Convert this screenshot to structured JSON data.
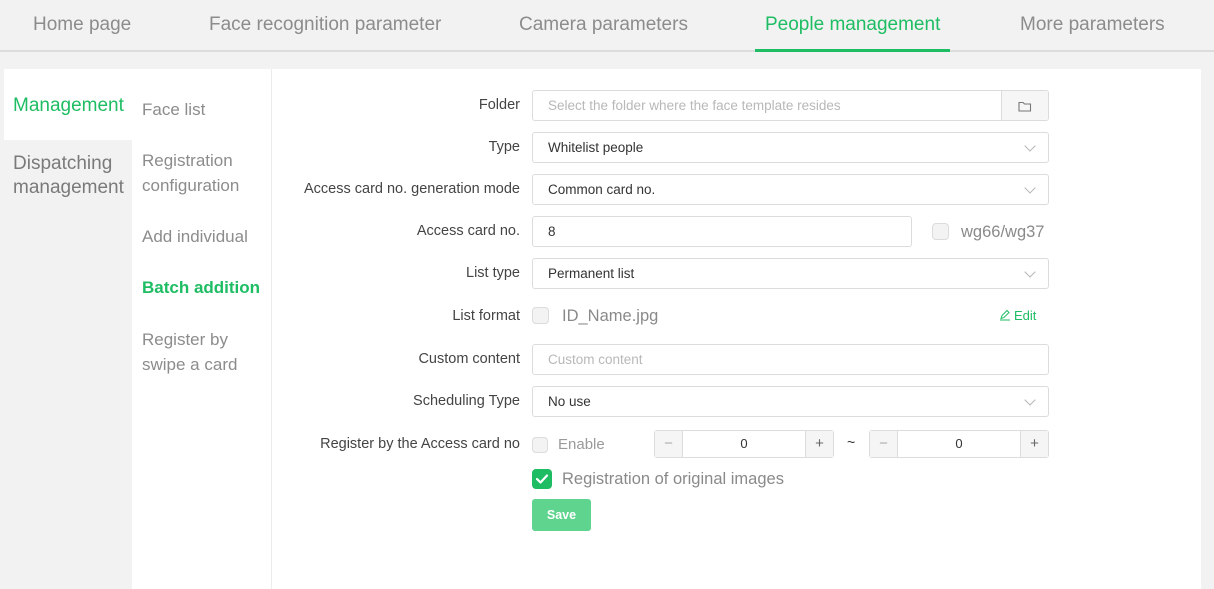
{
  "topnav": {
    "tabs": [
      {
        "label": "Home page"
      },
      {
        "label": "Face recognition parameter"
      },
      {
        "label": "Camera parameters"
      },
      {
        "label": "People management"
      },
      {
        "label": "More parameters"
      }
    ],
    "active_index": 3
  },
  "left_tabs": [
    {
      "label": "Management"
    },
    {
      "label": "Dispatching management"
    }
  ],
  "submenu": [
    {
      "label": "Face list"
    },
    {
      "label": "Registration configuration"
    },
    {
      "label": "Add individual"
    },
    {
      "label": "Batch addition"
    },
    {
      "label": "Register by swipe a card"
    }
  ],
  "form": {
    "folder": {
      "label": "Folder",
      "placeholder": "Select the folder where the face template resides"
    },
    "type": {
      "label": "Type",
      "value": "Whitelist people"
    },
    "card_mode": {
      "label": "Access card no. generation mode",
      "value": "Common card no."
    },
    "card_no": {
      "label": "Access card no.",
      "value": "8",
      "checkbox_label": "wg66/wg37"
    },
    "list_type": {
      "label": "List type",
      "value": "Permanent list"
    },
    "list_format": {
      "label": "List format",
      "value": "ID_Name.jpg",
      "edit_label": "Edit"
    },
    "custom_content": {
      "label": "Custom content",
      "placeholder": "Custom content"
    },
    "scheduling": {
      "label": "Scheduling Type",
      "value": "No use"
    },
    "register_card": {
      "label": "Register by the Access card no",
      "enable_label": "Enable",
      "from": "0",
      "to": "0",
      "separator": "~",
      "minus": "−",
      "plus": "+"
    },
    "original_images": {
      "label": "Registration of original images",
      "checked": true
    },
    "save_label": "Save"
  },
  "colors": {
    "accent": "#1ebd63",
    "save_button": "#5ed48e"
  },
  "icons": {
    "folder": "folder-icon",
    "edit": "pencil-icon",
    "dropdown": "chevron-down-icon",
    "check": "check-icon"
  }
}
